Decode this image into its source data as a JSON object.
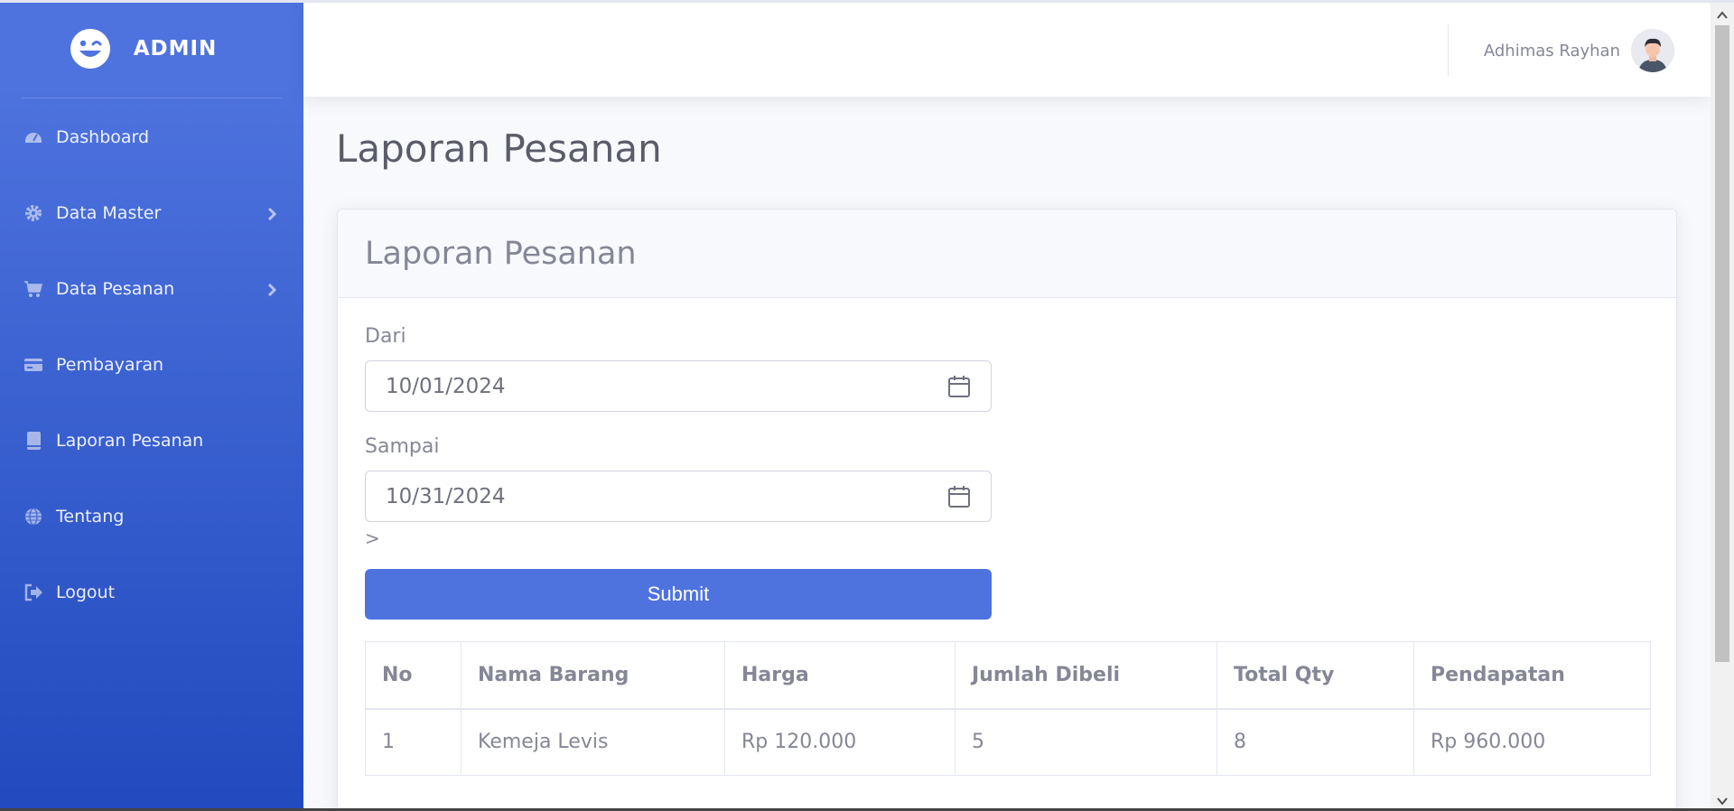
{
  "brand": {
    "name": "ADMIN"
  },
  "sidebar": {
    "items": [
      {
        "label": "Dashboard",
        "icon": "dashboard-icon",
        "has_submenu": false
      },
      {
        "label": "Data Master",
        "icon": "gear-icon",
        "has_submenu": true
      },
      {
        "label": "Data Pesanan",
        "icon": "cart-icon",
        "has_submenu": true
      },
      {
        "label": "Pembayaran",
        "icon": "credit-card-icon",
        "has_submenu": false
      },
      {
        "label": "Laporan Pesanan",
        "icon": "book-icon",
        "has_submenu": false
      },
      {
        "label": "Tentang",
        "icon": "globe-icon",
        "has_submenu": false
      },
      {
        "label": "Logout",
        "icon": "logout-icon",
        "has_submenu": false
      }
    ]
  },
  "topbar": {
    "user_name": "Adhimas Rayhan"
  },
  "page": {
    "title": "Laporan Pesanan"
  },
  "card": {
    "title": "Laporan Pesanan",
    "form": {
      "from_label": "Dari",
      "from_value": "10/01/2024",
      "to_label": "Sampai",
      "to_value": "10/31/2024",
      "stray_text": ">",
      "submit_label": "Submit"
    },
    "table": {
      "headers": [
        "No",
        "Nama Barang",
        "Harga",
        "Jumlah Dibeli",
        "Total Qty",
        "Pendapatan"
      ],
      "rows": [
        [
          "1",
          "Kemeja Levis",
          "Rp 120.000",
          "5",
          "8",
          "Rp 960.000"
        ]
      ]
    }
  },
  "colors": {
    "primary": "#4e73df",
    "sidebar_end": "#224abe",
    "text_muted": "#858796"
  }
}
